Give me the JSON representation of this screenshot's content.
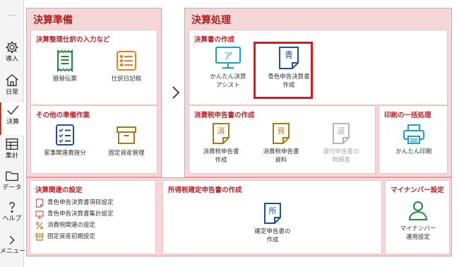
{
  "sidebar": {
    "more": "⋯",
    "items": [
      {
        "label": "導入",
        "icon": "gear-icon"
      },
      {
        "label": "日常",
        "icon": "home-icon"
      },
      {
        "label": "決算",
        "icon": "check-icon"
      },
      {
        "label": "集計",
        "icon": "table-icon"
      },
      {
        "label": "データ",
        "icon": "folder-icon"
      },
      {
        "label": "ヘルプ",
        "icon": "help-icon"
      },
      {
        "label": "メニュー",
        "icon": "chevron-right-icon"
      }
    ]
  },
  "prep": {
    "title": "決算準備",
    "entry": {
      "title": "決算整理仕訳の入力など",
      "tiles": [
        {
          "label": "振替伝票",
          "icon": "voucher-icon"
        },
        {
          "label": "仕訳日記帳",
          "icon": "journal-list-icon"
        }
      ]
    },
    "other": {
      "title": "その他の準備作業",
      "tiles": [
        {
          "label": "家事関連費按分",
          "icon": "checklist-icon"
        },
        {
          "label": "固定資産管理",
          "icon": "asset-box-icon"
        }
      ]
    }
  },
  "process": {
    "title": "決算処理",
    "create": {
      "title": "決算書の作成",
      "tiles": [
        {
          "l1": "かんたん決算",
          "l2": "アシスト",
          "glyph": "ア",
          "icon": "monitor-icon"
        },
        {
          "l1": "青色申告決算書",
          "l2": "作成",
          "glyph": "青",
          "icon": "blue-return-doc-icon"
        }
      ]
    },
    "tax": {
      "title": "消費税申告書の作成",
      "tiles": [
        {
          "l1": "消費税申告書",
          "l2": "作成",
          "glyph": "消",
          "icon": "consumption-doc-icon"
        },
        {
          "l1": "消費税申告書",
          "l2": "資料",
          "glyph": "資",
          "icon": "materials-doc-icon"
        },
        {
          "l1": "還付申告書の",
          "l2": "明細書",
          "glyph": "還",
          "icon": "refund-doc-icon"
        }
      ]
    },
    "print": {
      "title": "印刷の一括処理",
      "tiles": [
        {
          "label": "かんたん印刷",
          "icon": "printer-icon"
        }
      ]
    }
  },
  "settings": {
    "title": "決算関連の設定",
    "links": [
      {
        "label": "青色申告決算書項目設定",
        "icon": "doc-settings-icon"
      },
      {
        "label": "青色申告決算書集計設定",
        "icon": "monitor-settings-icon"
      },
      {
        "label": "消費税関連の設定",
        "icon": "percent-icon"
      },
      {
        "label": "固定資産初期設定",
        "icon": "asset-settings-icon"
      }
    ]
  },
  "income": {
    "title": "所得税確定申告書の作成",
    "tile": {
      "l1": "確定申告書の",
      "l2": "作成",
      "glyph": "所",
      "icon": "income-doc-icon"
    }
  },
  "mynumber": {
    "title": "マイナンバー設定",
    "tile": {
      "l1": "マイナンバー",
      "l2": "運用設定",
      "icon": "person-icon"
    }
  },
  "colors": {
    "panel_bg": "#f6d7d7",
    "panel_border": "#ea9c9c",
    "title_red": "#b02020",
    "accent_blue": "#1e6fb8",
    "accent_teal": "#1ba1c4",
    "accent_orange": "#f07c1a",
    "accent_green": "#1e8a3c",
    "accent_brown": "#a87a1a",
    "selection": "#e41515"
  }
}
